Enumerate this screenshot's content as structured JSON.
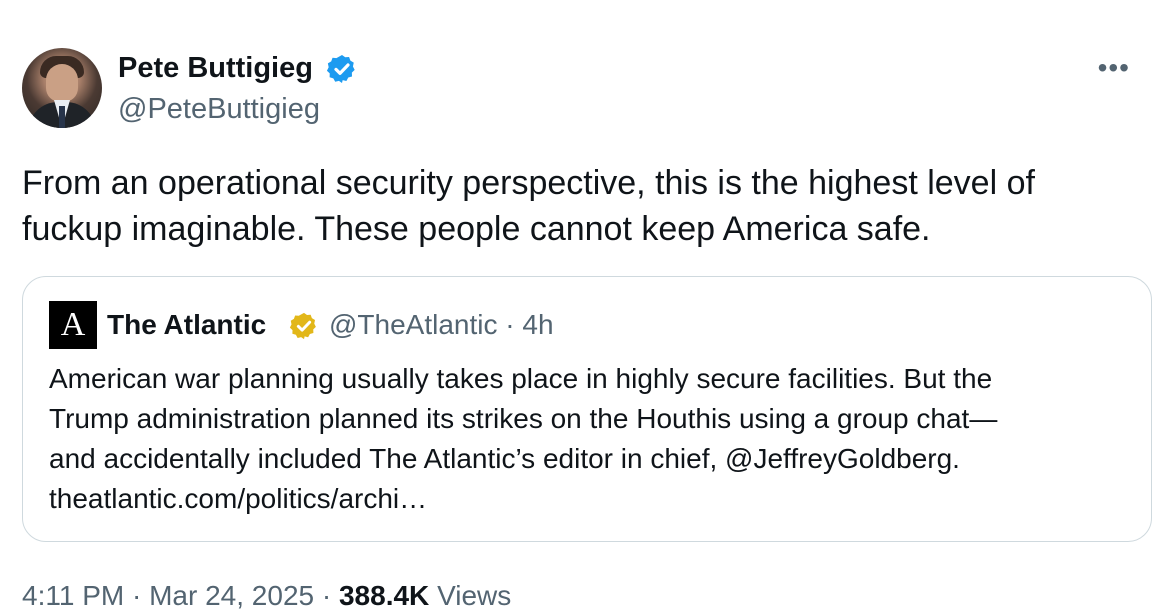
{
  "author": {
    "name": "Pete Buttigieg",
    "handle": "@PeteButtigieg"
  },
  "tweet": {
    "text": "From an operational security perspective, this is the highest level of fuckup imaginable. These people cannot keep America safe."
  },
  "quote": {
    "logo_letter": "A",
    "name": "The Atlantic",
    "handle": "@TheAtlantic",
    "time": "4h",
    "text_lines": [
      "American war planning usually takes place in highly secure facilities. But the",
      "Trump administration planned its strikes on the Houthis using a group chat—",
      "and accidentally included The Atlantic’s editor in chief, @JeffreyGoldberg.",
      "theatlantic.com/politics/archi…"
    ]
  },
  "meta": {
    "time": "4:11 PM",
    "date": "Mar 24, 2025",
    "views": "388.4K",
    "views_label": "Views"
  },
  "menu": {
    "icon": "more-icon"
  },
  "colors": {
    "verified_blue": "#1d9bf0",
    "verified_gold": "#e2b719",
    "secondary": "#536471",
    "border": "#cfd9de"
  }
}
